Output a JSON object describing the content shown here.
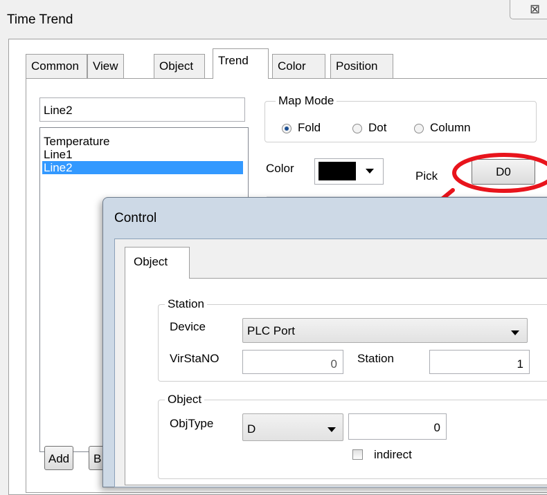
{
  "window": {
    "title": "Time Trend",
    "close_glyph": "⊠"
  },
  "tabs": [
    {
      "label": "Common"
    },
    {
      "label": "View"
    },
    {
      "label": "Object"
    },
    {
      "label": "Trend"
    },
    {
      "label": "Color"
    },
    {
      "label": "Position"
    }
  ],
  "active_tab": "Trend",
  "trend": {
    "name_value": "Line2",
    "series": [
      "Temperature",
      "Line1",
      "Line2"
    ],
    "selected_series": "Line2",
    "map_mode": {
      "label": "Map Mode",
      "options": [
        "Fold",
        "Dot",
        "Column"
      ],
      "selected": "Fold"
    },
    "color_label": "Color",
    "color_value": "#000000",
    "pick_label": "Pick",
    "pick_button": "D0",
    "buttons": {
      "add": "Add",
      "partial": "B"
    }
  },
  "control_dialog": {
    "title": "Control",
    "tab": "Object",
    "station": {
      "label": "Station",
      "device_label": "Device",
      "device_value": "PLC Port",
      "virstano_label": "VirStaNO",
      "virstano_value": "0",
      "station_label": "Station",
      "station_value": "1"
    },
    "object": {
      "label": "Object",
      "objtype_label": "ObjType",
      "objtype_value": "D",
      "address_value": "0",
      "indirect_label": "indirect",
      "indirect_checked": false
    }
  },
  "annotation_color": "#e8141c"
}
